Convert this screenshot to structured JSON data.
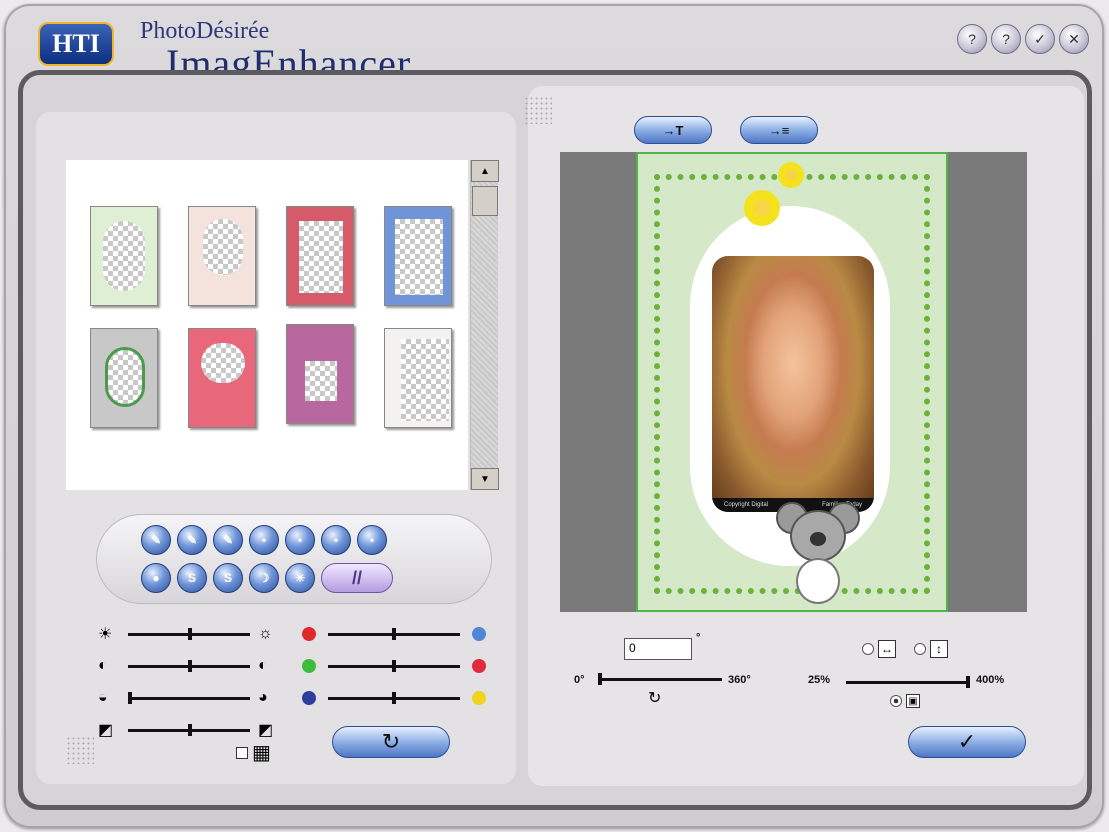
{
  "app": {
    "logo": "HTI",
    "title_prefix": "Photo",
    "title_brand": "Désirée",
    "title_main": "ImagEnhancer"
  },
  "window_buttons": [
    {
      "name": "help-icon",
      "glyph": "?"
    },
    {
      "name": "question-icon",
      "glyph": "?"
    },
    {
      "name": "check-icon",
      "glyph": "✓"
    },
    {
      "name": "close-icon",
      "glyph": "✕"
    }
  ],
  "scrollbar": {
    "up": "▲",
    "down": "▼"
  },
  "tools_row1": [
    "✎",
    "✎",
    "✎",
    "•",
    "•",
    "•",
    "•"
  ],
  "tools_row2": [
    "●",
    "S",
    "S",
    "☽",
    "✳"
  ],
  "wide_tool": "//",
  "sliders_left": [
    {
      "icon_left": "☀",
      "icon_right": "☼"
    },
    {
      "icon_left": "◐",
      "icon_right": "◐"
    },
    {
      "icon_left": "◒",
      "icon_right": "◕"
    },
    {
      "icon_left": "◩",
      "icon_right": "◩"
    }
  ],
  "sliders_color": [
    {
      "left_color": "#e02a2a",
      "right_color": "#4f86d6"
    },
    {
      "left_color": "#3dbb3d",
      "right_color": "#e02a3d"
    },
    {
      "left_color": "#2c3f9b",
      "right_color": "#f1d21c"
    }
  ],
  "grid_icon": "▦",
  "reset_icon": "↻",
  "top_buttons": [
    "→T",
    "→≡"
  ],
  "photo_bar": {
    "left": "Copyright Digital",
    "right": "Families Today"
  },
  "rotation": {
    "value": "0",
    "degree_mark": "°",
    "min": "0",
    "max": "360",
    "rotate_icon": "↻"
  },
  "zoom": {
    "min": "25%",
    "max": "400%",
    "fit_width_icon": "↔",
    "fit_height_icon": "↕",
    "actual_icon": "▣"
  },
  "ok_icon": "✓"
}
